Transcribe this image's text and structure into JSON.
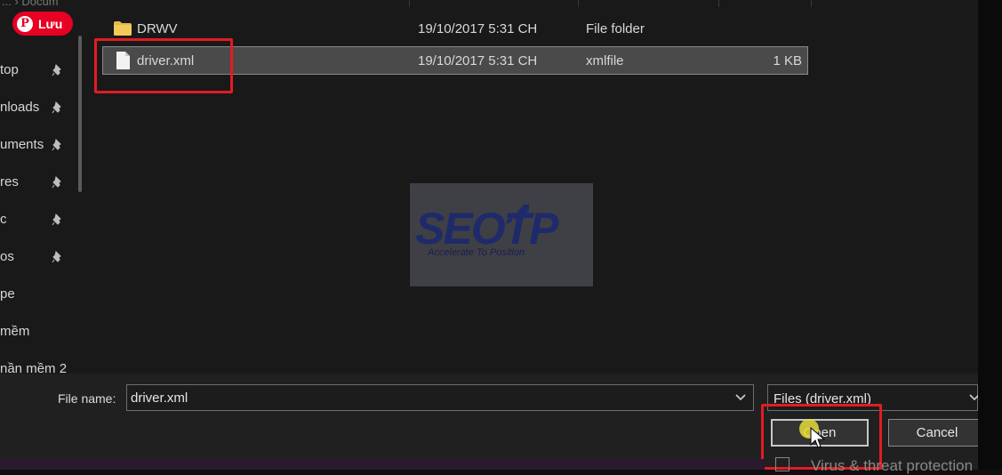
{
  "badge": {
    "label": "Lưu"
  },
  "nav": {
    "top_fragment": "... › Docum",
    "items": [
      {
        "label": "top",
        "pinned": true
      },
      {
        "label": "nloads",
        "pinned": true
      },
      {
        "label": "uments",
        "pinned": true
      },
      {
        "label": "res",
        "pinned": true
      },
      {
        "label": "c",
        "pinned": true
      },
      {
        "label": "os",
        "pinned": true
      },
      {
        "label": "pe",
        "pinned": false
      },
      {
        "label": " mềm",
        "pinned": false
      },
      {
        "label": "nần mềm 2",
        "pinned": false
      }
    ]
  },
  "files": [
    {
      "name": "DRWV",
      "date": "19/10/2017 5:31 CH",
      "type": "File folder",
      "size": "",
      "icon": "folder-icon",
      "selected": false
    },
    {
      "name": "driver.xml",
      "date": "19/10/2017 5:31 CH",
      "type": "xmlfile",
      "size": "1 KB",
      "icon": "file-icon",
      "selected": true
    }
  ],
  "watermark": {
    "brand": "SEOTP",
    "tagline": "Accelerate To Position"
  },
  "footer": {
    "file_name_label": "File name:",
    "file_name_value": "driver.xml",
    "file_type_filter": "Files (driver.xml)",
    "open_label": "Open",
    "cancel_label": "Cancel",
    "behind_text": "Virus & threat protection"
  },
  "colors": {
    "highlight": "#e31b23",
    "selection": "#4a4a4a",
    "folder": "#e8b84a"
  }
}
